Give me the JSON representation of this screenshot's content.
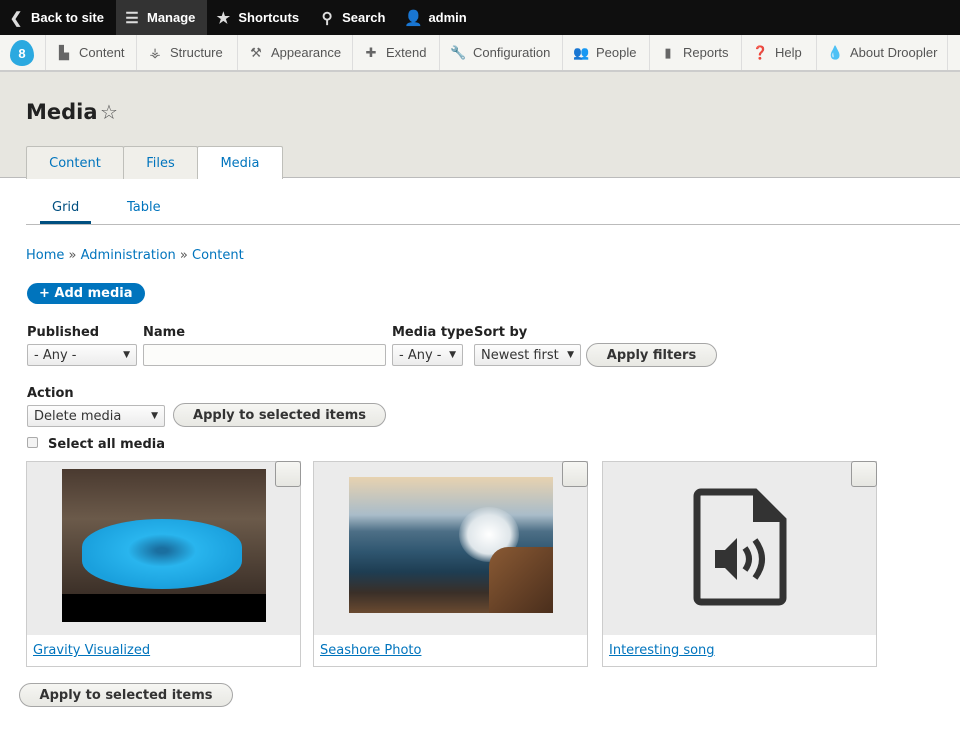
{
  "toolbar": {
    "back": "Back to site",
    "manage": "Manage",
    "shortcuts": "Shortcuts",
    "search": "Search",
    "user": "admin"
  },
  "tray": {
    "items": [
      "Content",
      "Structure",
      "Appearance",
      "Extend",
      "Configuration",
      "People",
      "Reports",
      "Help",
      "About Droopler"
    ]
  },
  "page": {
    "title": "Media"
  },
  "primary_tabs": [
    "Content",
    "Files",
    "Media"
  ],
  "secondary_tabs": [
    "Grid",
    "Table"
  ],
  "breadcrumb": {
    "home": "Home",
    "sep": "»",
    "admin": "Administration",
    "content": "Content"
  },
  "add_media": "+ Add media",
  "filters": {
    "published_label": "Published",
    "published_value": "- Any -",
    "name_label": "Name",
    "name_value": "",
    "type_label": "Media type",
    "type_value": "- Any -",
    "sort_label": "Sort by",
    "sort_value": "Newest first",
    "apply": "Apply filters"
  },
  "bulk": {
    "action_label": "Action",
    "action_value": "Delete media",
    "apply": "Apply to selected items",
    "select_all": "Select all media"
  },
  "media": [
    {
      "name": "Gravity Visualized",
      "type": "video"
    },
    {
      "name": "Seashore Photo",
      "type": "image"
    },
    {
      "name": "Interesting song",
      "type": "audio"
    }
  ],
  "bottom_apply": "Apply to selected items",
  "colors": {
    "link": "#0074bd",
    "toolbar": "#0f0f0f"
  }
}
